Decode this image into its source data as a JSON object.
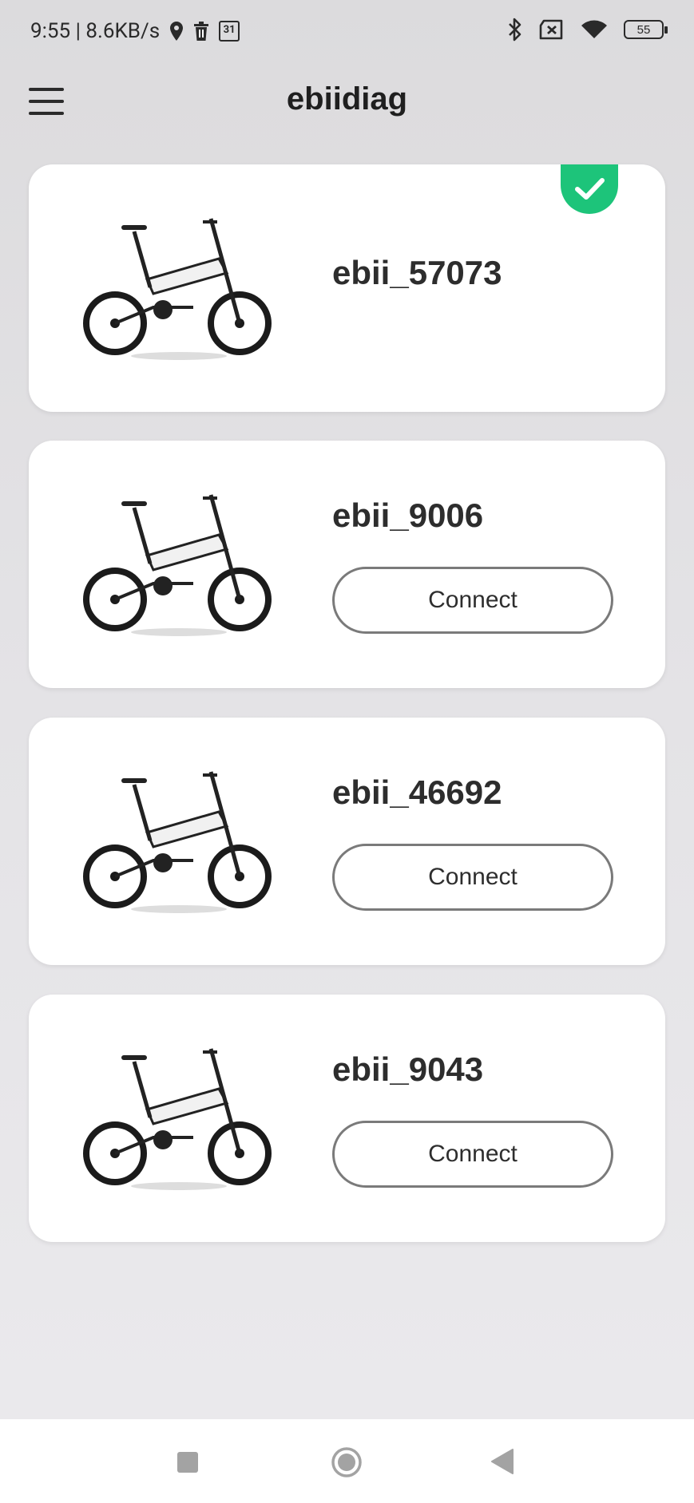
{
  "status_bar": {
    "time_speed": "9:55 | 8.6KB/s",
    "calendar_day": "31",
    "battery_level": "55"
  },
  "app_bar": {
    "title": "ebiidiag"
  },
  "devices": [
    {
      "name": "ebii_57073",
      "connected": true
    },
    {
      "name": "ebii_9006",
      "connected": false,
      "button_label": "Connect"
    },
    {
      "name": "ebii_46692",
      "connected": false,
      "button_label": "Connect"
    },
    {
      "name": "ebii_9043",
      "connected": false,
      "button_label": "Connect"
    }
  ],
  "colors": {
    "connected_badge": "#1dc47a",
    "background": "#e3e2e5",
    "card": "#ffffff"
  }
}
